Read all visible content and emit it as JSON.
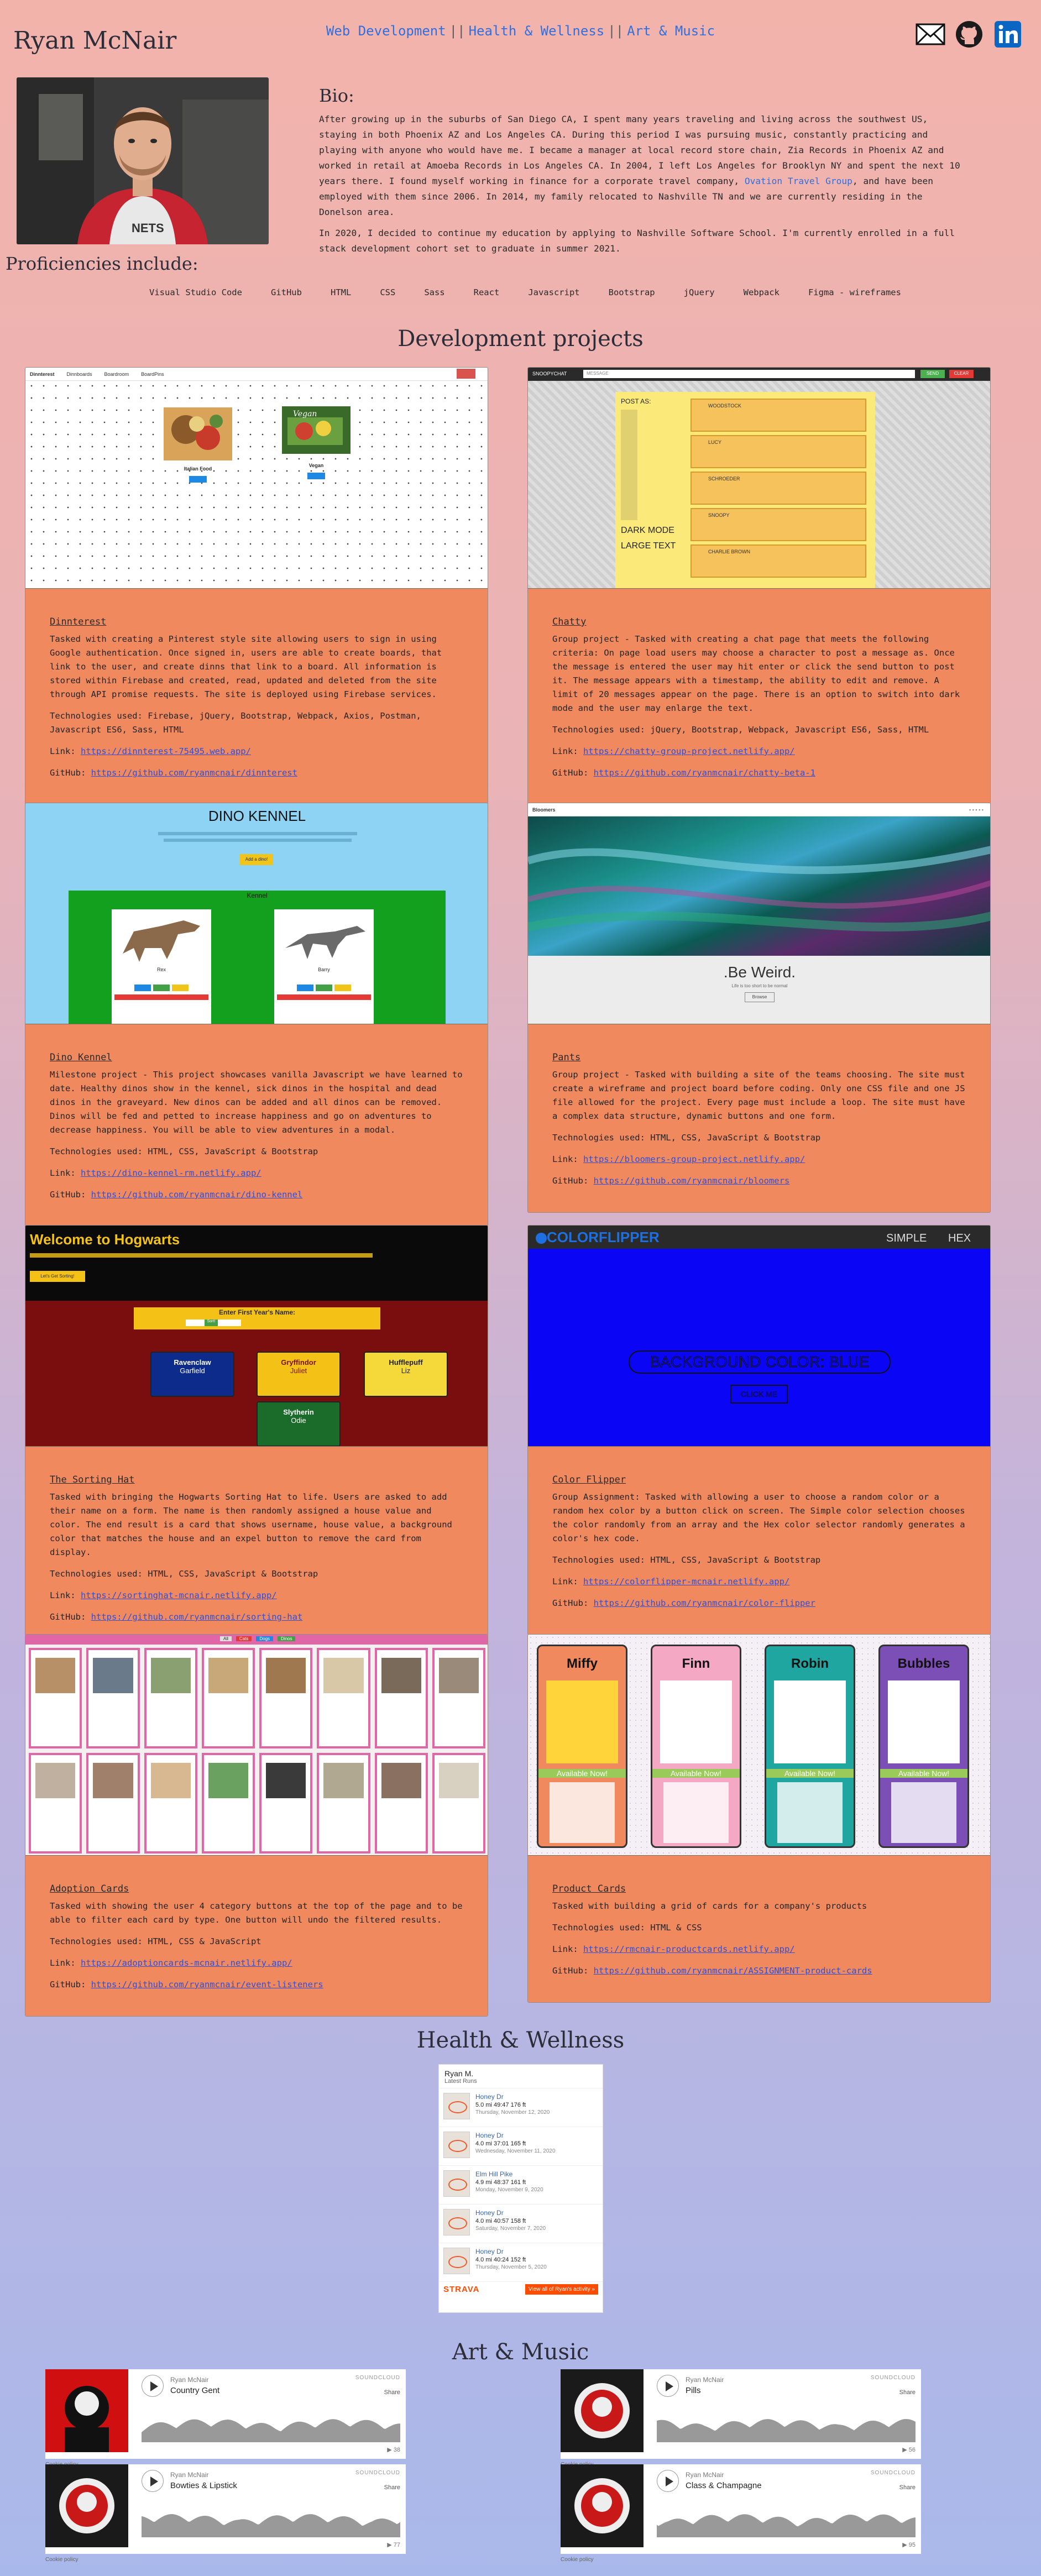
{
  "header": {
    "site_name": "Ryan McNair",
    "nav": [
      "Web Development",
      "Health & Wellness",
      "Art & Music"
    ],
    "nav_separator": "||",
    "social_icons": [
      "email-icon",
      "github-icon",
      "linkedin-icon"
    ]
  },
  "bio": {
    "title": "Bio:",
    "p1_a": "After growing up in the suburbs of San Diego CA, I spent many years traveling and living across the southwest US, staying in both Phoenix AZ and Los Angeles CA. During this period I was pursuing music, constantly practicing and playing with anyone who would have me. I became a manager at local record store chain, Zia Records in Phoenix AZ and worked in retail at Amoeba Records in Los Angeles CA. In 2004, I left Los Angeles for Brooklyn NY and spent the next 10 years there. I found myself working in finance for a corporate travel company, ",
    "p1_link": "Ovation Travel Group",
    "p1_b": ", and have been employed with them since 2006. In 2014, my family relocated to Nashville TN and we are currently residing in the Donelson area.",
    "p2": "In 2020, I decided to continue my education by applying to Nashville Software School. I'm currently enrolled in a full stack development cohort set to graduate in summer 2021."
  },
  "proficiencies": {
    "title": "Proficiencies include:",
    "items": [
      "Visual Studio Code",
      "GitHub",
      "HTML",
      "CSS",
      "Sass",
      "React",
      "Javascript",
      "Bootstrap",
      "jQuery",
      "Webpack",
      "Figma - wireframes"
    ]
  },
  "dev": {
    "heading": "Development projects",
    "projects": [
      {
        "title": "Dinnterest",
        "desc": "Tasked with creating a Pinterest style site allowing users to sign in using Google authentication. Once signed in, users are able to create boards, that link to the user, and create dinns that link to a board. All information is stored within Firebase and created, read, updated and deleted from the site through API promise requests. The site is deployed using Firebase services.",
        "tech": "Technologies used: Firebase, jQuery, Bootstrap, Webpack, Axios, Postman, Javascript ES6, Sass, HTML",
        "link_label": "Link:",
        "link": "https://dinnterest-75495.web.app/",
        "github_label": "GitHub:",
        "github": "https://github.com/ryanmcnair/dinnterest"
      },
      {
        "title": "Chatty",
        "desc": "Group project - Tasked with creating a chat page that meets the following criteria: On page load users may choose a character to post a message as. Once the message is entered the user may hit enter or click the send button to post it. The message appears with a timestamp, the ability to edit and remove. A limit of 20 messages appear on the page. There is an option to switch into dark mode and the user may enlarge the text.",
        "tech": "Technologies used: jQuery, Bootstrap, Webpack, Javascript ES6, Sass, HTML",
        "link_label": "Link:",
        "link": "https://chatty-group-project.netlify.app/",
        "github_label": "GitHub:",
        "github": "https://github.com/ryanmcnair/chatty-beta-1"
      },
      {
        "title": "Dino Kennel",
        "desc": "Milestone project - This project showcases vanilla Javascript we have learned to date. Healthy dinos show in the kennel, sick dinos in the hospital and dead dinos in the graveyard. New dinos can be added and all dinos can be removed. Dinos will be fed and petted to increase happiness and go on adventures to decrease happiness. You will be able to view adventures in a modal.",
        "tech": "Technologies used: HTML, CSS, JavaScript & Bootstrap",
        "link_label": "Link:",
        "link": "https://dino-kennel-rm.netlify.app/",
        "github_label": "GitHub:",
        "github": "https://github.com/ryanmcnair/dino-kennel"
      },
      {
        "title": "Pants",
        "desc": "Group project - Tasked with building a site of the teams choosing. The site must create a wireframe and project board before coding. Only one CSS file and one JS file allowed for the project. Every page must include a loop. The site must have a complex data structure, dynamic buttons and one form.",
        "tech": "Technologies used: HTML, CSS, JavaScript & Bootstrap",
        "link_label": "Link:",
        "link": "https://bloomers-group-project.netlify.app/",
        "github_label": "GitHub:",
        "github": "https://github.com/ryanmcnair/bloomers"
      },
      {
        "title": "The Sorting Hat",
        "desc": "Tasked with bringing the Hogwarts Sorting Hat to life. Users are asked to add their name on a form. The name is then randomly assigned a house value and color. The end result is a card that shows username, house value, a background color that matches the house and an expel button to remove the card from display.",
        "tech": "Technologies used: HTML, CSS, JavaScript & Bootstrap",
        "link_label": "Link:",
        "link": "https://sortinghat-mcnair.netlify.app/",
        "github_label": "GitHub:",
        "github": "https://github.com/ryanmcnair/sorting-hat"
      },
      {
        "title": "Color Flipper",
        "desc": "Group Assignment: Tasked with allowing a user to choose a random color or a random hex color by a button click on screen. The Simple color selection chooses the color randomly from an array and the Hex color selector randomly generates a color's hex code.",
        "tech": "Technologies used: HTML, CSS, JavaScript & Bootstrap",
        "link_label": "Link:",
        "link": "https://colorflipper-mcnair.netlify.app/",
        "github_label": "GitHub:",
        "github": "https://github.com/ryanmcnair/color-flipper"
      },
      {
        "title": "Adoption Cards",
        "desc": "Tasked with showing the user 4 category buttons at the top of the page and to be able to filter each card by type. One button will undo the filtered results.",
        "tech": "Technologies used: HTML, CSS & JavaScript",
        "link_label": "Link:",
        "link": "https://adoptioncards-mcnair.netlify.app/",
        "github_label": "GitHub:",
        "github": "https://github.com/ryanmcnair/event-listeners"
      },
      {
        "title": "Product Cards",
        "desc": "Tasked with building a grid of cards for a company's products",
        "tech": "Technologies used: HTML & CSS",
        "link_label": "Link:",
        "link": "https://rmcnair-productcards.netlify.app/",
        "github_label": "GitHub:",
        "github": "https://github.com/ryanmcnair/ASSIGNMENT-product-cards"
      }
    ]
  },
  "shots": {
    "dinnterest": {
      "nav": [
        "Dinnterest",
        "Dinnboards",
        "Boardroom",
        "BoardPins"
      ],
      "boards": [
        "Italian Food",
        "Vegan"
      ],
      "btn": "Delete"
    },
    "chatty": {
      "brand": "SNOOPYCHAT",
      "input": "MESSAGE",
      "send": "SEND",
      "clear": "CLEAR",
      "post_as": "POST AS:",
      "dark": "DARK MODE",
      "large": "LARGE TEXT",
      "users": [
        "WOODSTOCK",
        "LUCY",
        "SCHROEDER",
        "SNOOPY",
        "CHARLIE BROWN"
      ]
    },
    "dino": {
      "title": "DINO KENNEL",
      "kennel": "Kennel",
      "add": "Add a dino!",
      "dinos": [
        "Rex",
        "Barry"
      ]
    },
    "pants": {
      "brand": "Bloomers",
      "hero": ".Be Weird.",
      "sub": "Life is too short to be normal",
      "btn": "Browse"
    },
    "hogwarts": {
      "title": "Welcome to Hogwarts",
      "start": "Let's Get Sorting!",
      "form": "Enter First Year's Name:",
      "sort": "Sort!",
      "houses": [
        {
          "house": "Ravenclaw",
          "name": "Garfield",
          "color": "#0c2b8a",
          "text": "#ffffff"
        },
        {
          "house": "Gryffindor",
          "name": "Juliet",
          "color": "#f4c217",
          "text": "#7a1010"
        },
        {
          "house": "Hufflepuff",
          "name": "Liz",
          "color": "#f5d83a",
          "text": "#222222"
        },
        {
          "house": "Slytherin",
          "name": "Odie",
          "color": "#1b6b2a",
          "text": "#ffffff"
        }
      ]
    },
    "colorflipper": {
      "brand": "COLORFLIPPER",
      "simple": "SIMPLE",
      "hex": "HEX",
      "label": "BACKGROUND COLOR: BLUE",
      "btn": "CLICK ME",
      "bg": "#0a05f4"
    },
    "adoption": {
      "filters": [
        "All",
        "Cats",
        "Dogs",
        "Dinos"
      ]
    },
    "products": {
      "names": [
        "Miffy",
        "Finn",
        "Robin",
        "Bubbles"
      ],
      "available": "Available Now!",
      "colors": [
        "#f0895e",
        "#f5a8c4",
        "#20a6a0",
        "#7b4fb5"
      ]
    }
  },
  "health": {
    "heading": "Health & Wellness",
    "strava_user": "Ryan M.",
    "strava_sub": "Latest Runs",
    "runs": [
      {
        "name": "Honey Dr",
        "stats": "5.0 mi   49:47   176 ft",
        "date": "Thursday, November 12, 2020"
      },
      {
        "name": "Honey Dr",
        "stats": "4.0 mi   37:01   165 ft",
        "date": "Wednesday, November 11, 2020"
      },
      {
        "name": "Elm Hill Pike",
        "stats": "4.9 mi   48:37   161 ft",
        "date": "Monday, November 9, 2020"
      },
      {
        "name": "Honey Dr",
        "stats": "4.0 mi   40:57   158 ft",
        "date": "Saturday, November 7, 2020"
      },
      {
        "name": "Honey Dr",
        "stats": "4.0 mi   40:24   152 ft",
        "date": "Thursday, November 5, 2020"
      }
    ],
    "strava_brand": "STRAVA",
    "strava_btn": "View all of Ryan's activity »"
  },
  "music": {
    "heading": "Art & Music",
    "tracks": [
      {
        "artist": "Ryan McNair",
        "track": "Country Gent",
        "count": "▶ 38"
      },
      {
        "artist": "Ryan McNair",
        "track": "Pills",
        "count": "▶ 56"
      },
      {
        "artist": "Ryan McNair",
        "track": "Bowties & Lipstick",
        "count": "▶ 77"
      },
      {
        "artist": "Ryan McNair",
        "track": "Class & Champagne",
        "count": "▶ 95"
      }
    ],
    "brand": "SOUNDCLOUD",
    "share": "Share",
    "cookie": "Cookie policy"
  }
}
